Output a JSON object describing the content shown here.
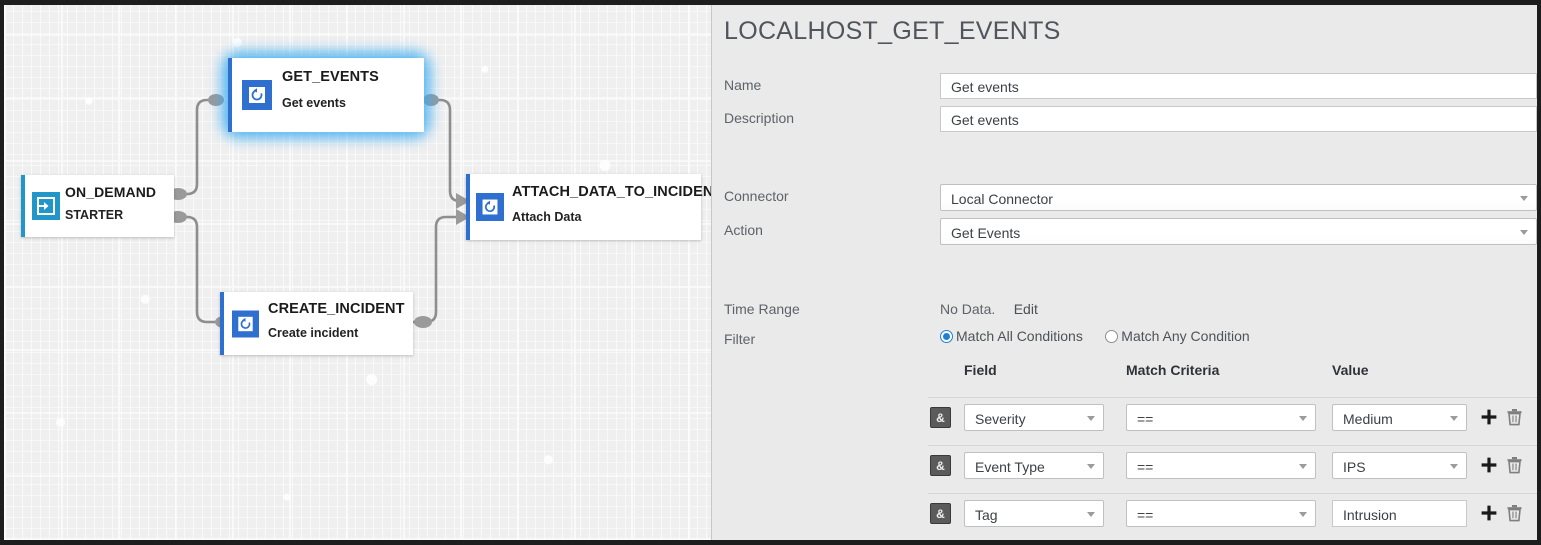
{
  "canvas": {
    "nodes": [
      {
        "id": "get_events",
        "title": "GET_EVENTS",
        "subtitle": "Get events",
        "icon": "refresh-icon",
        "selected": true,
        "accent": "#2f6fd0"
      },
      {
        "id": "on_demand",
        "title": "ON_DEMAND",
        "subtitle": "STARTER",
        "icon": "login-arrow-icon",
        "selected": false,
        "accent": "#2196c9"
      },
      {
        "id": "attach_data_to_incident",
        "title": "ATTACH_DATA_TO_INCIDENT",
        "subtitle": "Attach Data",
        "icon": "refresh-icon",
        "selected": false,
        "accent": "#2f6fd0"
      },
      {
        "id": "create_incident",
        "title": "CREATE_INCIDENT",
        "subtitle": "Create incident",
        "icon": "refresh-icon",
        "selected": false,
        "accent": "#2f6fd0"
      }
    ],
    "colors": {
      "background": "#efefef",
      "wire": "#8e8e8e",
      "endpoint": "#9a9a9a",
      "selection_glow": "#33a9f2"
    }
  },
  "panel": {
    "title": "LOCALHOST_GET_EVENTS",
    "fields": {
      "name_label": "Name",
      "name_value": "Get events",
      "description_label": "Description",
      "description_value": "Get events",
      "connector_label": "Connector",
      "connector_value": "Local Connector",
      "action_label": "Action",
      "action_value": "Get Events",
      "time_range_label": "Time Range",
      "time_range_value": "No Data.",
      "time_range_edit": "Edit",
      "filter_label": "Filter"
    },
    "filter_mode": {
      "match_all_label": "Match All Conditions",
      "match_all_selected": true,
      "match_any_label": "Match Any Condition",
      "match_any_selected": false
    },
    "filter_table": {
      "headers": [
        "Field",
        "Match Criteria",
        "Value"
      ],
      "rows": [
        {
          "op": "&",
          "field": "Severity",
          "criteria": "==",
          "value": "Medium",
          "value_is_select": true,
          "add": "+",
          "delete": "delete-icon"
        },
        {
          "op": "&",
          "field": "Event Type",
          "criteria": "==",
          "value": "IPS",
          "value_is_select": true,
          "add": "+",
          "delete": "delete-icon"
        },
        {
          "op": "&",
          "field": "Tag",
          "criteria": "==",
          "value": "Intrusion",
          "value_is_select": false,
          "add": "+",
          "delete": "delete-icon"
        }
      ]
    },
    "colors": {
      "panel_background": "#eaeaea",
      "title_text": "#4f555b",
      "label_text": "#5d6369",
      "radio_accent": "#1f7fd4"
    }
  }
}
